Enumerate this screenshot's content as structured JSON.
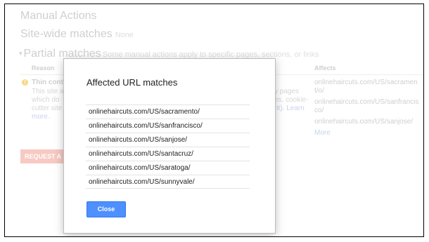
{
  "page": {
    "title": "Manual Actions",
    "site_wide": {
      "label": "Site-wide matches",
      "value": "None"
    },
    "partial": {
      "label": "Partial matches",
      "subtitle": "Some manual actions apply to specific pages, sections, or links"
    },
    "columns": {
      "reason": "Reason",
      "affects": "Affects"
    },
    "reason_row": {
      "title": "Thin cont",
      "desc_left": [
        "This site a",
        "which do",
        "cutter site",
        "more."
      ],
      "desc_right": [
        "y pages",
        "es, cookie-",
        "nt). Learn"
      ]
    },
    "affects_items": [
      "onlinehaircuts.com/US/sacrament/o/",
      "onlinehaircuts.com/US/sanfrancisco/",
      "onlinehaircuts.com/US/sanjose/"
    ],
    "affects_more": "More",
    "request_button": "REQUEST A"
  },
  "dialog": {
    "title": "Affected URL matches",
    "urls": [
      "onlinehaircuts.com/US/sacramento/",
      "onlinehaircuts.com/US/sanfrancisco/",
      "onlinehaircuts.com/US/sanjose/",
      "onlinehaircuts.com/US/santacruz/",
      "onlinehaircuts.com/US/saratoga/",
      "onlinehaircuts.com/US/sunnyvale/"
    ],
    "close_label": "Close"
  },
  "colors": {
    "primary_button": "#4d90fe",
    "request_button": "#f6c9c2",
    "warning": "#f6d98a"
  }
}
